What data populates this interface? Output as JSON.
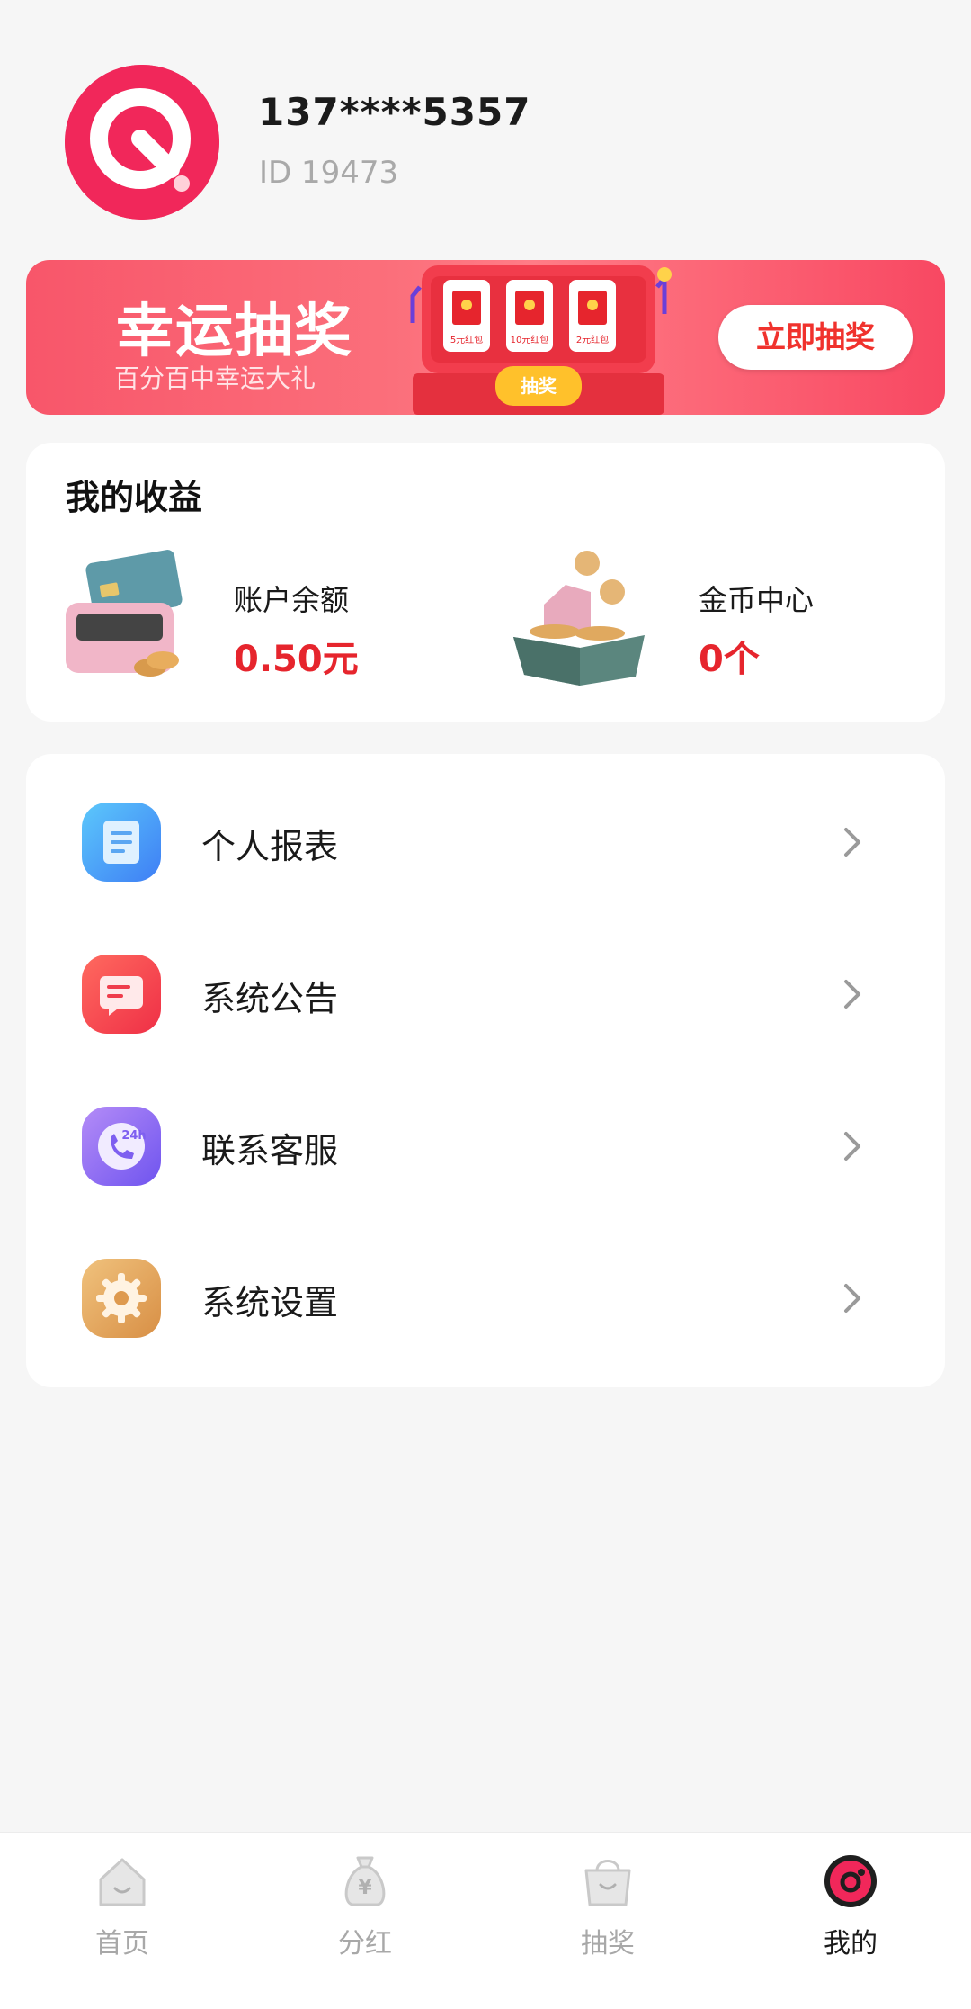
{
  "profile": {
    "phone": "137****5357",
    "id_text": "ID 19473",
    "avatar_icon": "app-logo-icon"
  },
  "banner": {
    "title": "幸运抽奖",
    "subtitle": "百分百中幸运大礼",
    "button": "立即抽奖",
    "slot_button": "抽奖",
    "slot_cards": [
      "5元红包",
      "10元红包",
      "2元红包"
    ]
  },
  "earnings": {
    "title": "我的收益",
    "balance": {
      "label": "账户余额",
      "value": "0.50元",
      "icon": "wallet-icon"
    },
    "coins": {
      "label": "金币中心",
      "value": "0个",
      "icon": "coin-box-icon"
    }
  },
  "menu": [
    {
      "label": "个人报表",
      "icon": "report-icon",
      "color": "#4a9ef7"
    },
    {
      "label": "系统公告",
      "icon": "announcement-icon",
      "color": "#f2414a"
    },
    {
      "label": "联系客服",
      "icon": "phone-24h-icon",
      "color": "#8a6cf2"
    },
    {
      "label": "系统设置",
      "icon": "gear-icon",
      "color": "#e0a45a"
    }
  ],
  "nav": [
    {
      "label": "首页",
      "icon": "home-icon",
      "active": false
    },
    {
      "label": "分红",
      "icon": "money-bag-icon",
      "active": false
    },
    {
      "label": "抽奖",
      "icon": "shopping-bag-icon",
      "active": false
    },
    {
      "label": "我的",
      "icon": "profile-icon",
      "active": true
    }
  ],
  "colors": {
    "accent": "#f1275a",
    "value_red": "#e6252d",
    "background": "#f6f6f6"
  }
}
